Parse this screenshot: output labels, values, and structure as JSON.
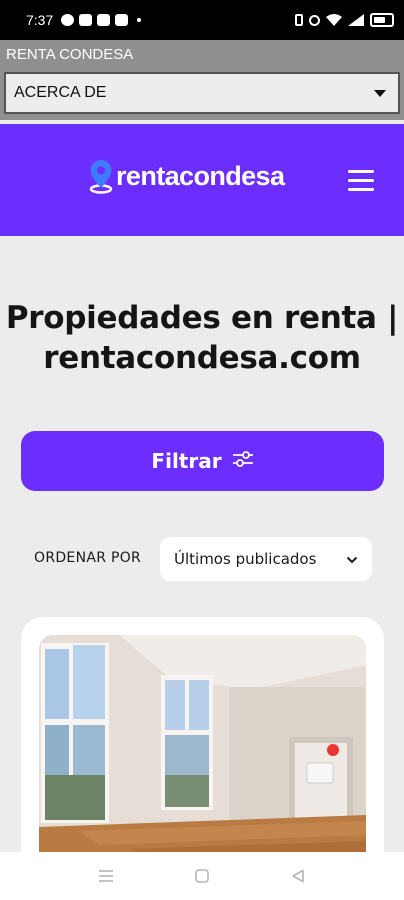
{
  "status_bar": {
    "time": "7:37"
  },
  "app": {
    "title": "RENTA CONDESA",
    "nav_select_value": "ACERCA DE"
  },
  "header": {
    "logo_text": "rentacondesa",
    "brand_color": "#6b2eff"
  },
  "main": {
    "title_line1": "Propiedades en renta |",
    "title_line2": "rentacondesa.com",
    "filter_label": "Filtrar",
    "sort_label": "ORDENAR POR",
    "sort_value": "Últimos publicados"
  },
  "icons": {
    "menu": "hamburger-icon",
    "filter": "sliders-icon",
    "logo": "location-pin-icon",
    "nav_recent": "recents-icon",
    "nav_home": "home-icon",
    "nav_back": "back-icon"
  }
}
